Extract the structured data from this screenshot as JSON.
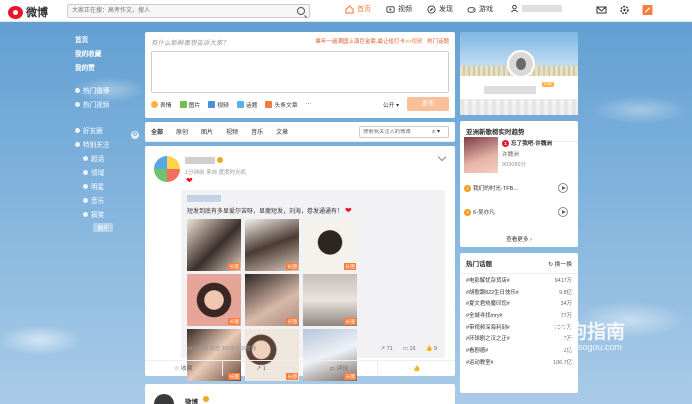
{
  "colors": {
    "accent": "#fa7d3c",
    "brand_red": "#e6162d",
    "sky": "#5f9dd1"
  },
  "topbar": {
    "logo": "微博",
    "search_placeholder": "大家正在搜：高考作文，搜人",
    "nav": [
      {
        "label": "首页",
        "icon": "home-icon"
      },
      {
        "label": "视频",
        "icon": "video-icon"
      },
      {
        "label": "发现",
        "icon": "discover-icon"
      },
      {
        "label": "游戏",
        "icon": "game-icon"
      }
    ],
    "icons": [
      "mail-icon",
      "gear-icon",
      "compose-icon"
    ]
  },
  "leftnav": {
    "main": [
      "首页",
      "我的收藏",
      "我的赞"
    ],
    "hot": [
      "热门微博",
      "热门视频"
    ],
    "groups": [
      "好友圈",
      "特别关注"
    ],
    "subs": [
      "超话",
      "领域",
      "明星",
      "音乐",
      "搞笑"
    ],
    "expand": "展开"
  },
  "publisher": {
    "question": "有什么新鲜事想告诉大家？",
    "hot_prefix": "乘年一遍满国上演巨金套,最让给打卡",
    "hot_link": ">>视频",
    "hot_tag": "热门话题",
    "tools": [
      "表情",
      "图片",
      "视频",
      "话题",
      "头条文章",
      "···"
    ],
    "visibility": "公开",
    "submit": "发布"
  },
  "feed_tabs": {
    "tabs": [
      "全部",
      "原创",
      "图片",
      "视频",
      "音乐",
      "文章"
    ],
    "search_placeholder": "搜索我关注人的微博"
  },
  "post": {
    "meta": "1分钟前 来自 度度时光机",
    "repost_text": "短发到底有多显爱尔苦呀，显瘦短发，刘海，卷发通通有！",
    "repost_footer": "44分钟前 来自 360安全浏览器",
    "photo_tag": "长图",
    "repost_stats": [
      {
        "icon": "share-icon",
        "value": "71"
      },
      {
        "icon": "comment-icon",
        "value": "16"
      },
      {
        "icon": "like-icon",
        "value": "9"
      }
    ],
    "actions": [
      "收藏",
      "1",
      "评论",
      ""
    ]
  },
  "post2": {
    "name": "微博"
  },
  "profile": {
    "level": "Lv8"
  },
  "music": {
    "title": "亚洲新歌榜实时趋势",
    "first": {
      "rank": "1",
      "title": "忘了我吧-许魏洲",
      "artist": "许魏洲",
      "count": "909089分"
    },
    "rows": [
      {
        "rank": "2",
        "title": "我们的时光-TFB..."
      },
      {
        "rank": "3",
        "title": "6-吴亦凡"
      }
    ],
    "more": "查看更多 ›"
  },
  "topics": {
    "title": "热门话题",
    "switch": "换一换",
    "items": [
      {
        "name": "#电影解忧杂货店#",
        "value": "9417万"
      },
      {
        "name": "#胡歌跟822生日快乐#",
        "value": "9.8亿"
      },
      {
        "name": "#夏文君热魔印您#",
        "value": "34万"
      },
      {
        "name": "#全城寻找mry#",
        "value": "77万"
      },
      {
        "name": "#带视频深海利刻#",
        "value": "7072万"
      },
      {
        "name": "#环球剧之汉之正#",
        "value": "2万"
      },
      {
        "name": "#看剧德#",
        "value": "2亿"
      },
      {
        "name": "#运动教室#",
        "value": "106.7亿"
      }
    ]
  },
  "watermark": {
    "text": "搜狗指南",
    "url": "zhinan.sogou.com"
  }
}
